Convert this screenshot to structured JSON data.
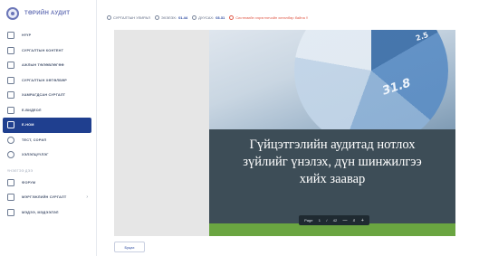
{
  "app": {
    "logo_text": "ТӨРИЙН АУДИТ"
  },
  "sidebar": {
    "items": [
      {
        "label": "НҮҮР",
        "icon": "home-icon"
      },
      {
        "label": "СУРГАЛТЫН КОНТЕНТ",
        "icon": "book-icon"
      },
      {
        "label": "АЖЛЫН ТӨЛӨВЛӨГӨӨ",
        "icon": "calendar-icon"
      },
      {
        "label": "СУРГАЛТЫН ХӨТӨЛБӨР",
        "icon": "document-icon"
      },
      {
        "label": "ХАМРАГДСАН СУРГАЛТ",
        "icon": "checklist-icon"
      },
      {
        "label": "Е-ВИДЕОЛ",
        "icon": "video-icon"
      },
      {
        "label": "Е-НОМ",
        "icon": "ebook-icon"
      },
      {
        "label": "ТЕСТ, СОРИЛ",
        "icon": "clock-icon"
      },
      {
        "label": "ХЭЛЭЛЦҮҮЛЭГ",
        "icon": "chat-icon"
      }
    ],
    "section_label": "ҮНЭЛГЭЭ ДЭЭ",
    "items2": [
      {
        "label": "ФОРУМ",
        "icon": "forum-icon"
      },
      {
        "label": "МЭРГЭЖЛИЙН СУРГАЛТ",
        "icon": "training-icon"
      },
      {
        "label": "МЭДЭЭ, МЭДЭЭЛЭЛ",
        "icon": "news-icon"
      }
    ],
    "active_index": 6
  },
  "topbar": {
    "label_1": "СУРГАЛТЫН УЛИРАЛ",
    "label_2": "ЭХЭЛЭХ:",
    "value_2": "01.44",
    "label_3": "ДУУСАХ:",
    "value_3": "03.31",
    "warning": "Системийн хэрэглэгчийн хөтөлбөр байна !!"
  },
  "slide": {
    "number_main": "31.8",
    "number_small": "2.5",
    "title_line1": "Гүйцэтгэлийн аудитад нотлох",
    "title_line2": "зүйлийг үнэлэх, дүн шинжилгээ",
    "title_line3": "хийх заавар"
  },
  "pager": {
    "page_label": "Page",
    "current": "1",
    "separator": "/",
    "total": "42",
    "zoom_out": "—",
    "zoom_in": "+"
  },
  "back_button": "Буцах",
  "colors": {
    "accent": "#1f3f8f",
    "green": "#6aa541",
    "warn": "#e05b4a"
  }
}
